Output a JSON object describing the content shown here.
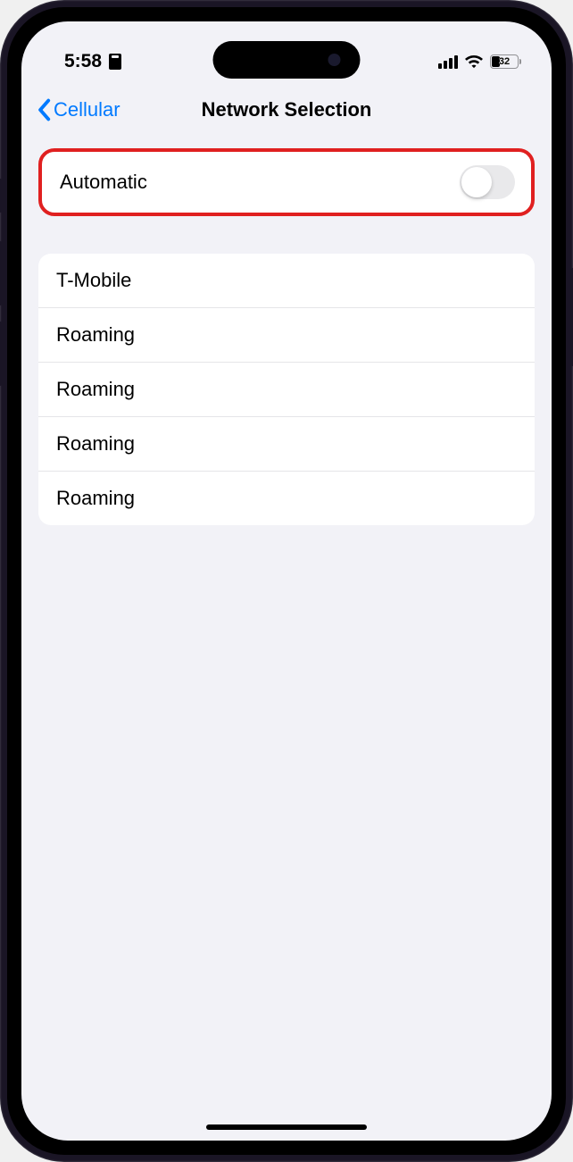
{
  "status_bar": {
    "time": "5:58",
    "battery_percent": "32"
  },
  "nav": {
    "back_label": "Cellular",
    "title": "Network Selection"
  },
  "automatic": {
    "label": "Automatic",
    "enabled": false
  },
  "networks": [
    {
      "label": "T-Mobile"
    },
    {
      "label": "Roaming"
    },
    {
      "label": "Roaming"
    },
    {
      "label": "Roaming"
    },
    {
      "label": "Roaming"
    }
  ]
}
